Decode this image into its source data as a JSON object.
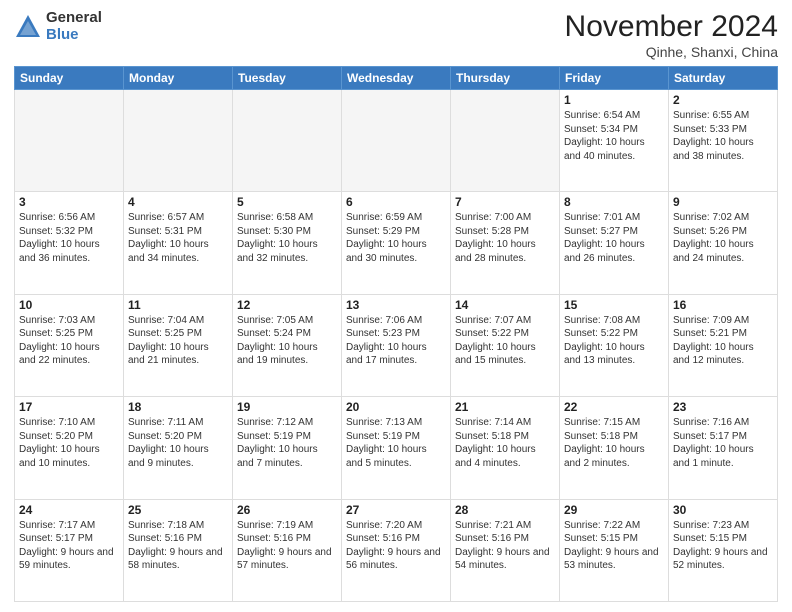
{
  "header": {
    "logo_general": "General",
    "logo_blue": "Blue",
    "month_title": "November 2024",
    "location": "Qinhe, Shanxi, China"
  },
  "weekdays": [
    "Sunday",
    "Monday",
    "Tuesday",
    "Wednesday",
    "Thursday",
    "Friday",
    "Saturday"
  ],
  "weeks": [
    [
      {
        "day": "",
        "empty": true
      },
      {
        "day": "",
        "empty": true
      },
      {
        "day": "",
        "empty": true
      },
      {
        "day": "",
        "empty": true
      },
      {
        "day": "",
        "empty": true
      },
      {
        "day": "1",
        "info": "Sunrise: 6:54 AM\nSunset: 5:34 PM\nDaylight: 10 hours\nand 40 minutes."
      },
      {
        "day": "2",
        "info": "Sunrise: 6:55 AM\nSunset: 5:33 PM\nDaylight: 10 hours\nand 38 minutes."
      }
    ],
    [
      {
        "day": "3",
        "info": "Sunrise: 6:56 AM\nSunset: 5:32 PM\nDaylight: 10 hours\nand 36 minutes."
      },
      {
        "day": "4",
        "info": "Sunrise: 6:57 AM\nSunset: 5:31 PM\nDaylight: 10 hours\nand 34 minutes."
      },
      {
        "day": "5",
        "info": "Sunrise: 6:58 AM\nSunset: 5:30 PM\nDaylight: 10 hours\nand 32 minutes."
      },
      {
        "day": "6",
        "info": "Sunrise: 6:59 AM\nSunset: 5:29 PM\nDaylight: 10 hours\nand 30 minutes."
      },
      {
        "day": "7",
        "info": "Sunrise: 7:00 AM\nSunset: 5:28 PM\nDaylight: 10 hours\nand 28 minutes."
      },
      {
        "day": "8",
        "info": "Sunrise: 7:01 AM\nSunset: 5:27 PM\nDaylight: 10 hours\nand 26 minutes."
      },
      {
        "day": "9",
        "info": "Sunrise: 7:02 AM\nSunset: 5:26 PM\nDaylight: 10 hours\nand 24 minutes."
      }
    ],
    [
      {
        "day": "10",
        "info": "Sunrise: 7:03 AM\nSunset: 5:25 PM\nDaylight: 10 hours\nand 22 minutes."
      },
      {
        "day": "11",
        "info": "Sunrise: 7:04 AM\nSunset: 5:25 PM\nDaylight: 10 hours\nand 21 minutes."
      },
      {
        "day": "12",
        "info": "Sunrise: 7:05 AM\nSunset: 5:24 PM\nDaylight: 10 hours\nand 19 minutes."
      },
      {
        "day": "13",
        "info": "Sunrise: 7:06 AM\nSunset: 5:23 PM\nDaylight: 10 hours\nand 17 minutes."
      },
      {
        "day": "14",
        "info": "Sunrise: 7:07 AM\nSunset: 5:22 PM\nDaylight: 10 hours\nand 15 minutes."
      },
      {
        "day": "15",
        "info": "Sunrise: 7:08 AM\nSunset: 5:22 PM\nDaylight: 10 hours\nand 13 minutes."
      },
      {
        "day": "16",
        "info": "Sunrise: 7:09 AM\nSunset: 5:21 PM\nDaylight: 10 hours\nand 12 minutes."
      }
    ],
    [
      {
        "day": "17",
        "info": "Sunrise: 7:10 AM\nSunset: 5:20 PM\nDaylight: 10 hours\nand 10 minutes."
      },
      {
        "day": "18",
        "info": "Sunrise: 7:11 AM\nSunset: 5:20 PM\nDaylight: 10 hours\nand 9 minutes."
      },
      {
        "day": "19",
        "info": "Sunrise: 7:12 AM\nSunset: 5:19 PM\nDaylight: 10 hours\nand 7 minutes."
      },
      {
        "day": "20",
        "info": "Sunrise: 7:13 AM\nSunset: 5:19 PM\nDaylight: 10 hours\nand 5 minutes."
      },
      {
        "day": "21",
        "info": "Sunrise: 7:14 AM\nSunset: 5:18 PM\nDaylight: 10 hours\nand 4 minutes."
      },
      {
        "day": "22",
        "info": "Sunrise: 7:15 AM\nSunset: 5:18 PM\nDaylight: 10 hours\nand 2 minutes."
      },
      {
        "day": "23",
        "info": "Sunrise: 7:16 AM\nSunset: 5:17 PM\nDaylight: 10 hours\nand 1 minute."
      }
    ],
    [
      {
        "day": "24",
        "info": "Sunrise: 7:17 AM\nSunset: 5:17 PM\nDaylight: 9 hours\nand 59 minutes."
      },
      {
        "day": "25",
        "info": "Sunrise: 7:18 AM\nSunset: 5:16 PM\nDaylight: 9 hours\nand 58 minutes."
      },
      {
        "day": "26",
        "info": "Sunrise: 7:19 AM\nSunset: 5:16 PM\nDaylight: 9 hours\nand 57 minutes."
      },
      {
        "day": "27",
        "info": "Sunrise: 7:20 AM\nSunset: 5:16 PM\nDaylight: 9 hours\nand 56 minutes."
      },
      {
        "day": "28",
        "info": "Sunrise: 7:21 AM\nSunset: 5:16 PM\nDaylight: 9 hours\nand 54 minutes."
      },
      {
        "day": "29",
        "info": "Sunrise: 7:22 AM\nSunset: 5:15 PM\nDaylight: 9 hours\nand 53 minutes."
      },
      {
        "day": "30",
        "info": "Sunrise: 7:23 AM\nSunset: 5:15 PM\nDaylight: 9 hours\nand 52 minutes."
      }
    ]
  ]
}
